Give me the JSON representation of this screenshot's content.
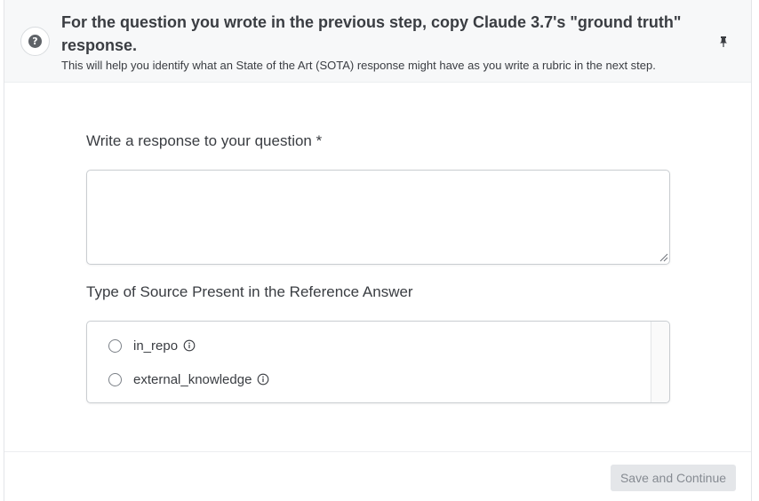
{
  "header": {
    "title": "For the question you wrote in the previous step, copy Claude 3.7's \"ground truth\" response.",
    "subtitle": "This will help you identify what an State of the Art (SOTA) response might have as you write a rubric in the next step.",
    "help_icon": "question-mark-icon",
    "help_glyph": "?",
    "pin_icon": "pin-icon"
  },
  "response_field": {
    "label": "Write a response to your question *",
    "value": "",
    "placeholder": ""
  },
  "source_field": {
    "label": "Type of Source Present in the Reference Answer",
    "options": [
      {
        "label": "in_repo",
        "selected": false,
        "icon": "info-icon"
      },
      {
        "label": "external_knowledge",
        "selected": false,
        "icon": "info-icon"
      }
    ]
  },
  "footer": {
    "save_label": "Save and Continue"
  }
}
